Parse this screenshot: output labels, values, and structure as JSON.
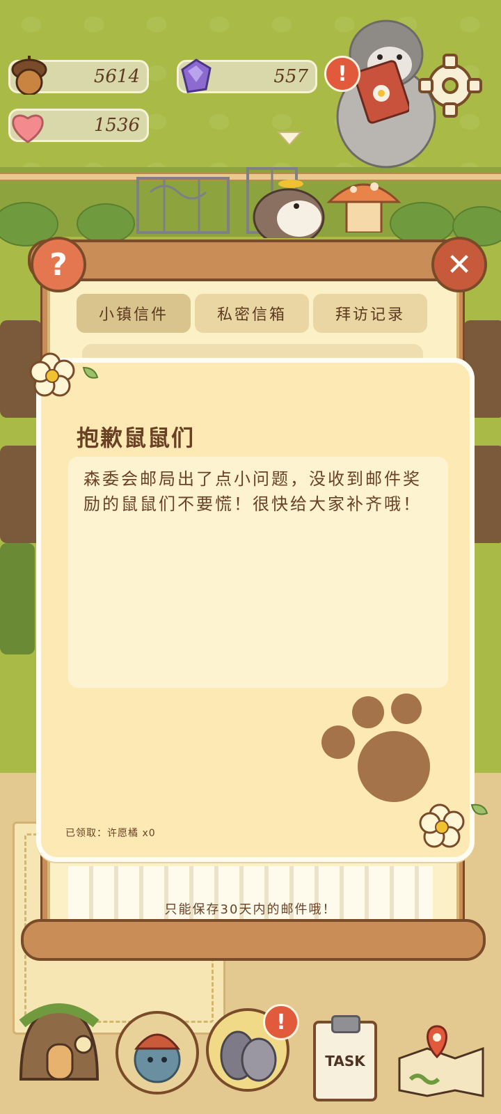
{
  "hud": {
    "acorns": "5614",
    "gems": "557",
    "hearts": "1536"
  },
  "mail": {
    "tabs": [
      "小镇信件",
      "私密信箱",
      "拜访记录"
    ],
    "active_tab_index": 0,
    "letter": {
      "title": "抱歉鼠鼠们",
      "body": "森委会邮局出了点小问题，没收到邮件奖励的鼠鼠们不要慌！很快给大家补齐哦！",
      "claimed": "已领取：许愿橘 x0"
    },
    "notice": "只能保存30天内的邮件哦！"
  },
  "nav": {
    "task_label": "TASK",
    "alert_mark": "!"
  },
  "icons": [
    "acorn-icon",
    "gem-icon",
    "heart-icon",
    "gear-icon",
    "help-icon",
    "close-icon",
    "paw-icon",
    "home-icon",
    "map-icon"
  ],
  "colors": {
    "grass": "#a9bb46",
    "board_wood": "#c98e57",
    "letter_bg": "#fce9b4",
    "text_brown": "#6a4125",
    "alert_red": "#e25a3c"
  }
}
